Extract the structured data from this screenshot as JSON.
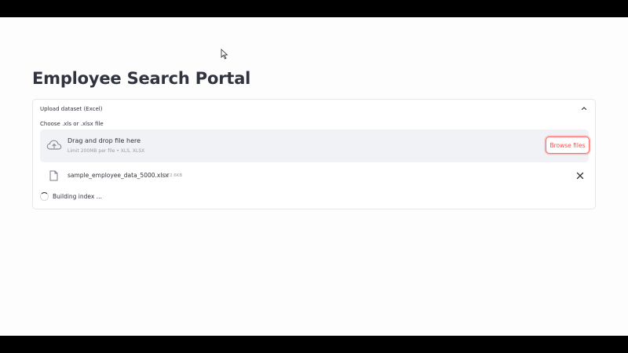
{
  "page": {
    "title": "Employee Search Portal"
  },
  "uploader": {
    "expander_title": "Upload dataset (Excel)",
    "field_label": "Choose .xls or .xlsx file",
    "dropzone_title": "Drag and drop file here",
    "dropzone_subtitle": "Limit 200MB per file • XLS, XLSX",
    "browse_label": "Browse files"
  },
  "file": {
    "name": "sample_employee_data_5000.xlsx",
    "size": "172.6KB"
  },
  "status": {
    "text": "Building index ..."
  },
  "icons": {
    "cloud": "cloud-upload-icon",
    "file": "file-icon",
    "close": "close-icon",
    "chevron": "chevron-up-icon"
  },
  "colors": {
    "accent": "#ff4b4b",
    "text": "#31333f",
    "muted": "#9a9ca5",
    "dropzone_bg": "#f0f2f6"
  }
}
